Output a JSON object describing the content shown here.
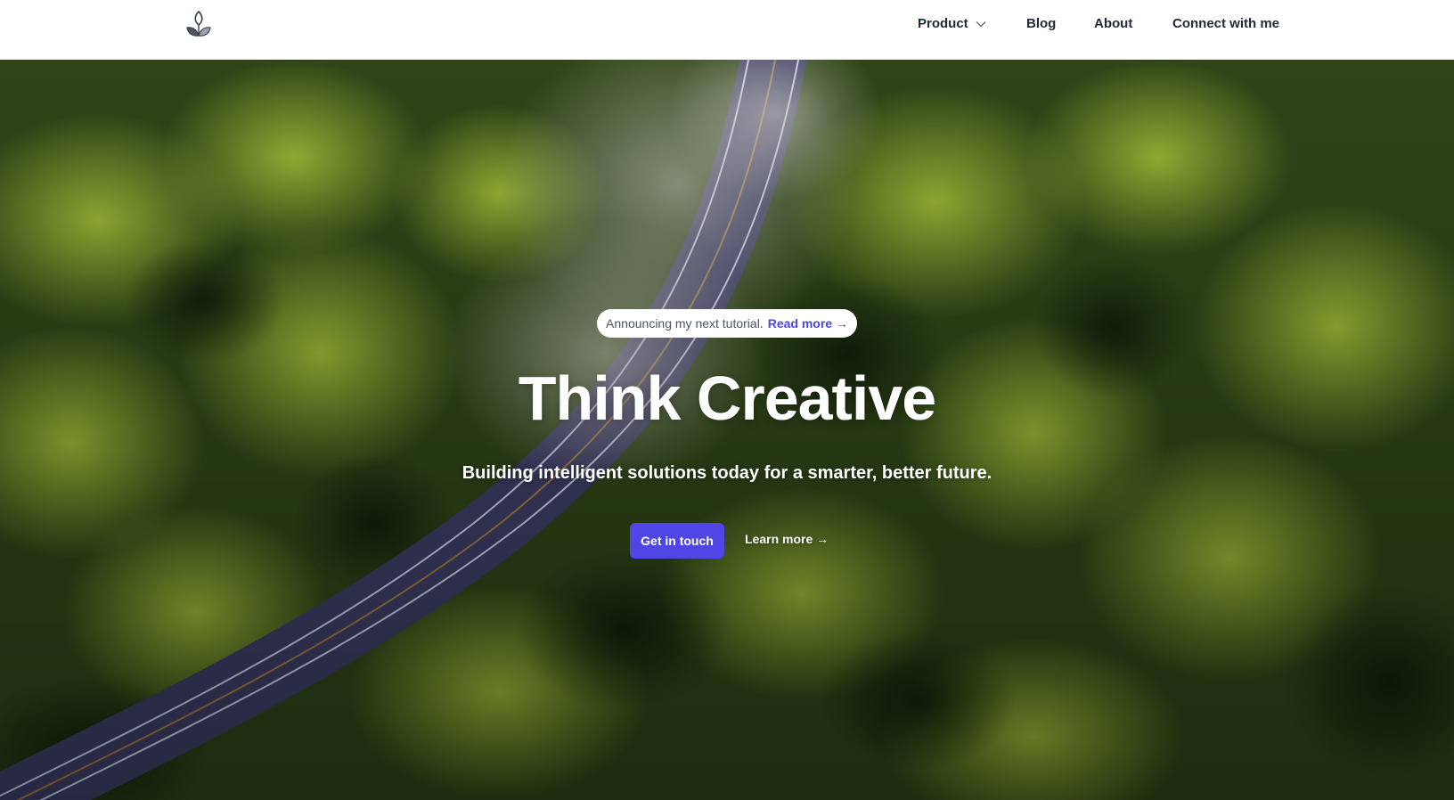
{
  "nav": {
    "logo_icon": "leaf-sprout-icon",
    "items": [
      {
        "label": "Product",
        "has_dropdown": true
      },
      {
        "label": "Blog"
      },
      {
        "label": "About"
      },
      {
        "label": "Connect with me"
      }
    ]
  },
  "hero": {
    "announcement": {
      "text": "Announcing my next tutorial.",
      "link": "Read more →"
    },
    "title": "Think Creative",
    "subtitle": "Building intelligent solutions today for a smarter, better future.",
    "primary_cta": "Get in touch",
    "secondary_cta": "Learn more →"
  },
  "colors": {
    "accent": "#4f46e5",
    "header_bg": "#ffffff",
    "nav_text": "#1f2937"
  }
}
